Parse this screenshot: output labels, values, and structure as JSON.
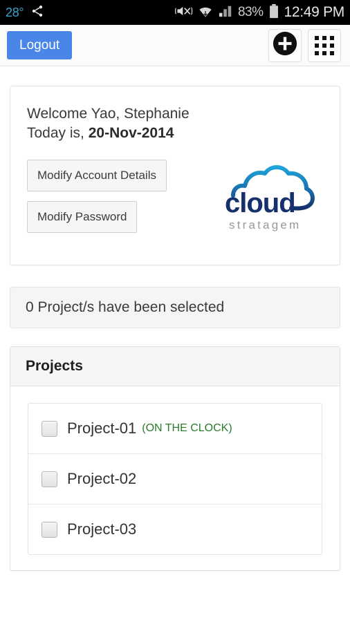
{
  "status_bar": {
    "temperature": "28°",
    "share_icon": "share-icon",
    "mute_icon": "volume-mute-vibrate-icon",
    "wifi_icon": "wifi-icon",
    "signal_icon": "cellular-signal-icon",
    "battery_percent": "83%",
    "battery_icon": "battery-icon",
    "time": "12:49 PM"
  },
  "action_bar": {
    "logout_label": "Logout",
    "add_button_icon": "plus-circle-icon",
    "apps_button_icon": "grid-apps-icon"
  },
  "welcome_card": {
    "greeting": "Welcome Yao, Stephanie",
    "today_prefix": "Today is, ",
    "today_date": "20-Nov-2014",
    "modify_account_label": "Modify Account Details",
    "modify_password_label": "Modify Password",
    "logo": {
      "name": "cloud-stratagem-logo",
      "primary_text": "cloud",
      "secondary_text": "stratagem",
      "cloud_top_color": "#1a9ed4",
      "cloud_bottom_color": "#15306b",
      "word_color": "#16306b",
      "tagline_color": "#9a9a9a"
    }
  },
  "selection_bar": {
    "text": "0 Project/s have been selected"
  },
  "projects_panel": {
    "title": "Projects",
    "items": [
      {
        "name": "Project-01",
        "status": "(ON THE CLOCK)",
        "checked": false
      },
      {
        "name": "Project-02",
        "status": "",
        "checked": false
      },
      {
        "name": "Project-03",
        "status": "",
        "checked": false
      }
    ]
  },
  "colors": {
    "accent_blue": "#4a86e8",
    "status_green": "#2a7a2a",
    "page_background": "#ffffff",
    "panel_header": "#f6f6f6"
  }
}
